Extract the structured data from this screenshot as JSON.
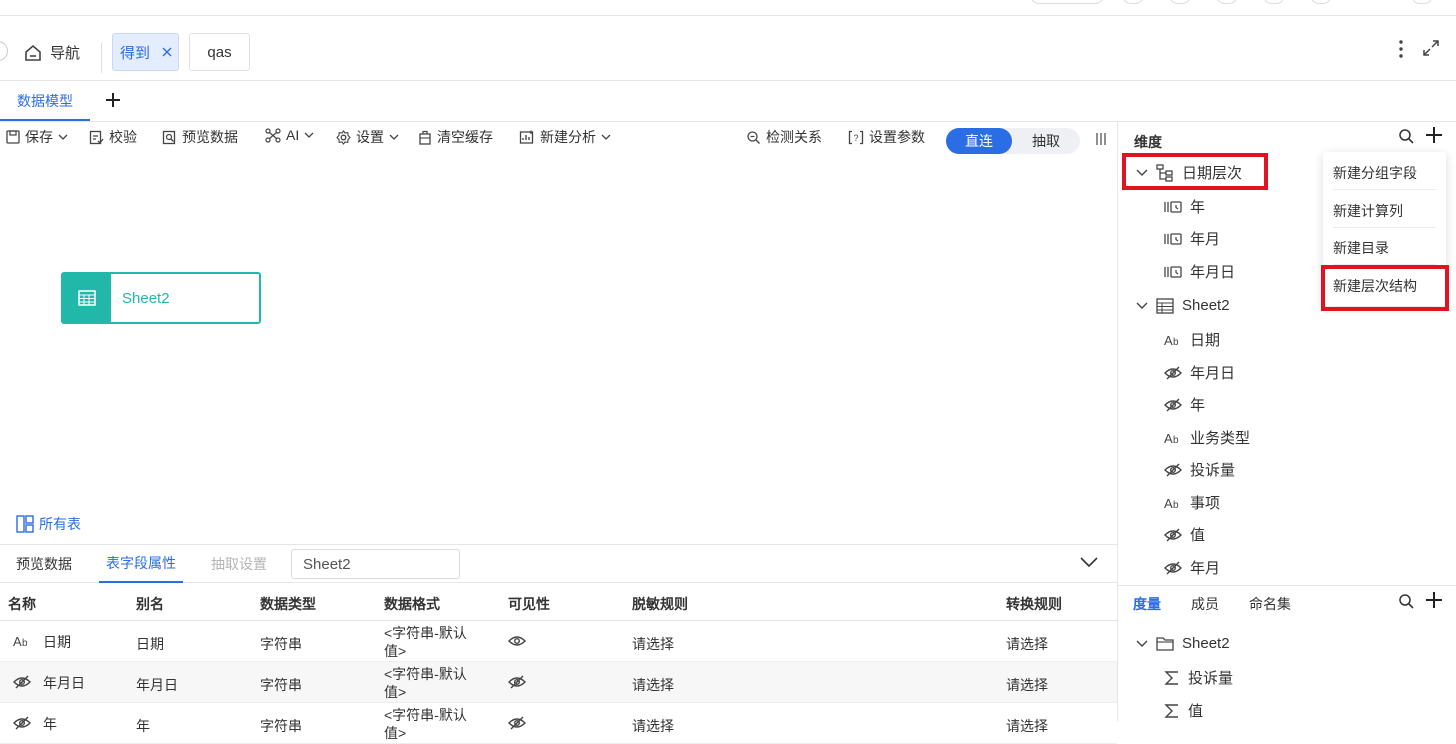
{
  "nav": {
    "home_label": "导航",
    "tabs": [
      {
        "label": "得到",
        "active": true
      },
      {
        "label": "qas",
        "active": false
      }
    ]
  },
  "model_tabs": {
    "active": "数据模型"
  },
  "toolbar": {
    "save": "保存",
    "validate": "校验",
    "preview": "预览数据",
    "ai": "AI",
    "settings": "设置",
    "clear_cache": "清空缓存",
    "new_analysis": "新建分析",
    "detect_relation": "检测关系",
    "set_params": "设置参数",
    "mode_direct": "直连",
    "mode_extract": "抽取"
  },
  "canvas": {
    "node_label": "Sheet2",
    "all_tables": "所有表"
  },
  "bottom": {
    "tabs": [
      "预览数据",
      "表字段属性",
      "抽取设置"
    ],
    "active_tab": "表字段属性",
    "sheet_input_value": "Sheet2",
    "columns": [
      "名称",
      "别名",
      "数据类型",
      "数据格式",
      "可见性",
      "脱敏规则",
      "转换规则"
    ],
    "rows": [
      {
        "icon": "text-type-icon",
        "name": "日期",
        "alias": "日期",
        "type": "字符串",
        "format_line1": "<字符串-默认",
        "format_line2": "值>",
        "visibility": "eye-icon",
        "mask": "请选择",
        "convert": "请选择"
      },
      {
        "icon": "hidden-icon",
        "name": "年月日",
        "alias": "年月日",
        "type": "字符串",
        "format_line1": "<字符串-默认",
        "format_line2": "值>",
        "visibility": "eye-off-icon",
        "mask": "请选择",
        "convert": "请选择"
      },
      {
        "icon": "hidden-icon",
        "name": "年",
        "alias": "年",
        "type": "字符串",
        "format_line1": "<字符串-默认",
        "format_line2": "值>",
        "visibility": "eye-off-icon",
        "mask": "请选择",
        "convert": "请选择"
      }
    ]
  },
  "right_panel": {
    "dimension_title": "维度",
    "hierarchy": {
      "label": "日期层次",
      "children": [
        "年",
        "年月",
        "年月日"
      ]
    },
    "table": {
      "label": "Sheet2",
      "fields": [
        {
          "icon": "text-type-icon",
          "label": "日期"
        },
        {
          "icon": "hidden-icon",
          "label": "年月日"
        },
        {
          "icon": "hidden-icon",
          "label": "年"
        },
        {
          "icon": "text-type-icon",
          "label": "业务类型"
        },
        {
          "icon": "hidden-icon",
          "label": "投诉量"
        },
        {
          "icon": "text-type-icon",
          "label": "事项"
        },
        {
          "icon": "hidden-icon",
          "label": "值"
        },
        {
          "icon": "hidden-icon",
          "label": "年月"
        }
      ]
    },
    "menu": [
      "新建分组字段",
      "新建计算列",
      "新建目录",
      "新建层次结构"
    ],
    "measure_tabs": [
      "度量",
      "成员",
      "命名集"
    ],
    "measure_tree": {
      "label": "Sheet2",
      "items": [
        "投诉量",
        "值"
      ]
    }
  },
  "colors": {
    "accent": "#2b6de5",
    "teal": "#21b8a9",
    "highlight": "#e0141e"
  }
}
